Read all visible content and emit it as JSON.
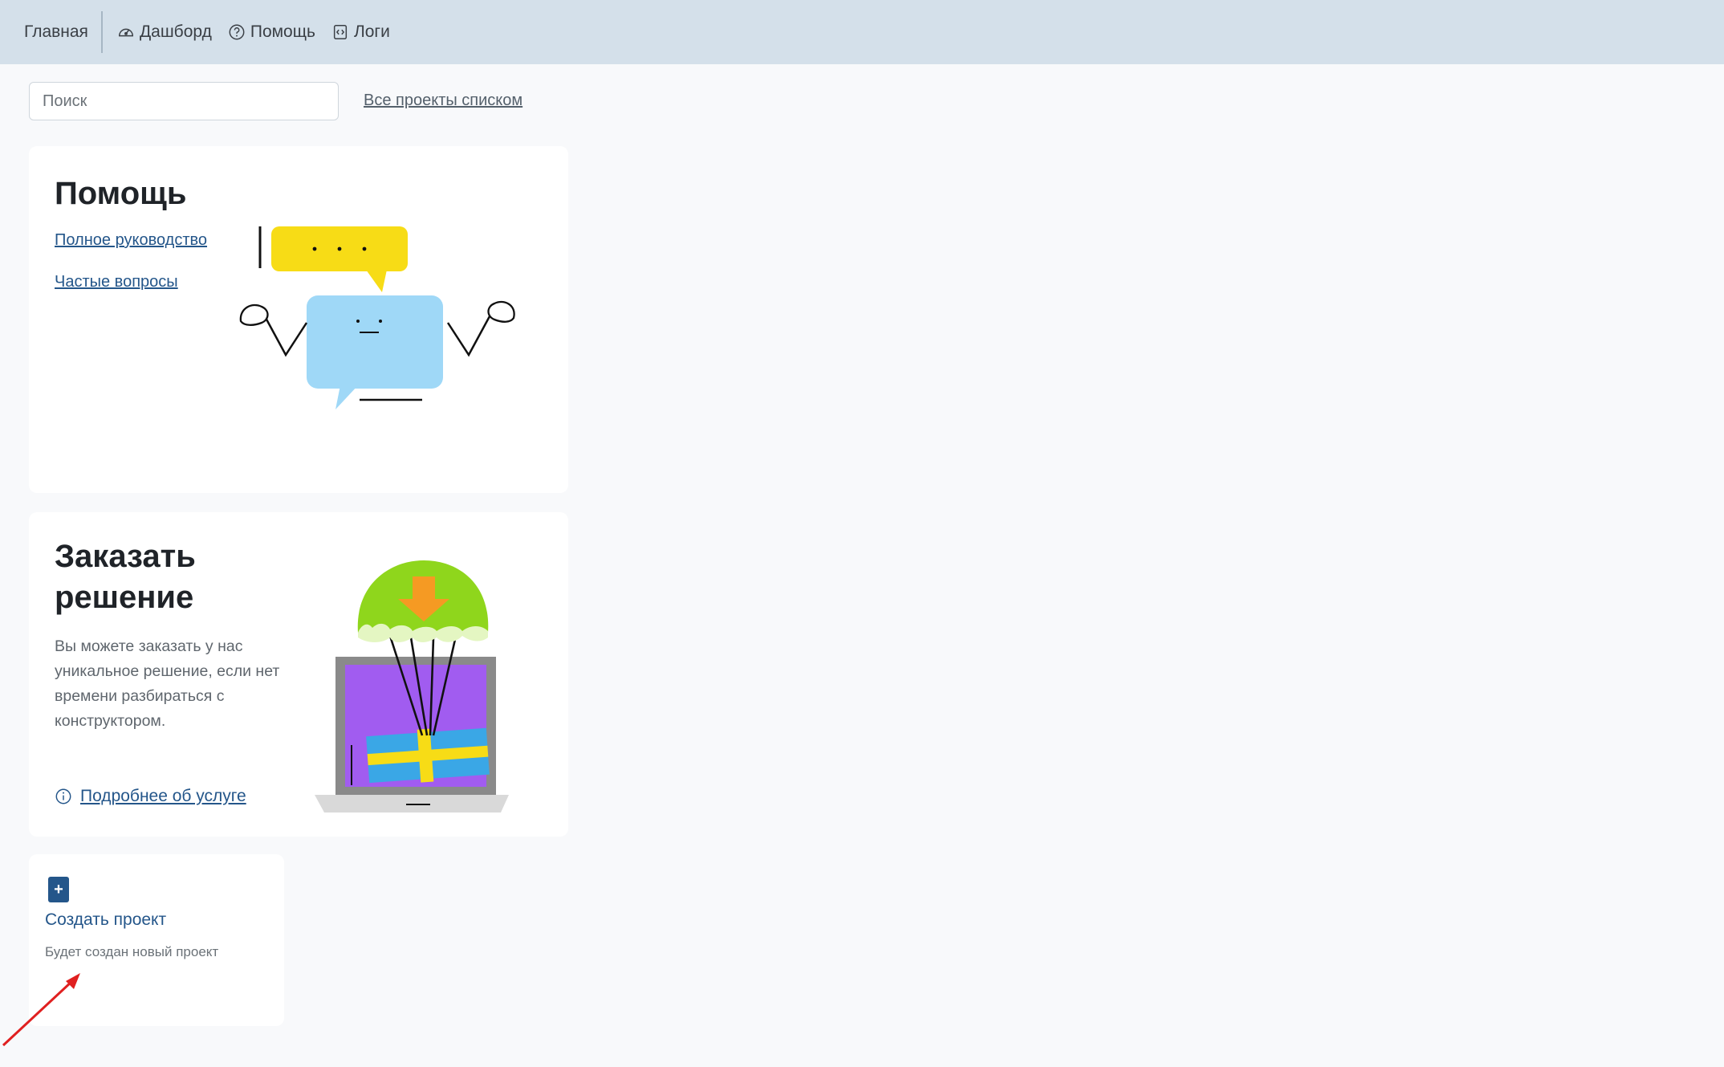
{
  "navbar": {
    "home_label": "Главная",
    "dashboard_label": "Дашборд",
    "help_label": "Помощь",
    "logs_label": "Логи",
    "background": "#d4e0ea"
  },
  "search": {
    "placeholder": "Поиск",
    "value": ""
  },
  "all_projects_link": "Все проекты списком",
  "help_card": {
    "title": "Помощь",
    "links": [
      {
        "label": "Полное руководство"
      },
      {
        "label": "Частые вопросы"
      }
    ],
    "illustration_icon": "chat-bubble-character"
  },
  "order_card": {
    "title": "Заказать решение",
    "description": "Вы можете заказать у нас уникальное решение, если нет времени разбираться с конструктором.",
    "more_link": "Подробнее об услуге",
    "illustration_icon": "parachute-laptop-gift"
  },
  "create_card": {
    "plus_label": "+",
    "title": "Создать проект",
    "description": "Будет создан новый проект"
  },
  "colors": {
    "link": "#24568a",
    "page_bg": "#f8f9fb",
    "card_bg": "#ffffff",
    "annotation_arrow": "#e02020"
  }
}
